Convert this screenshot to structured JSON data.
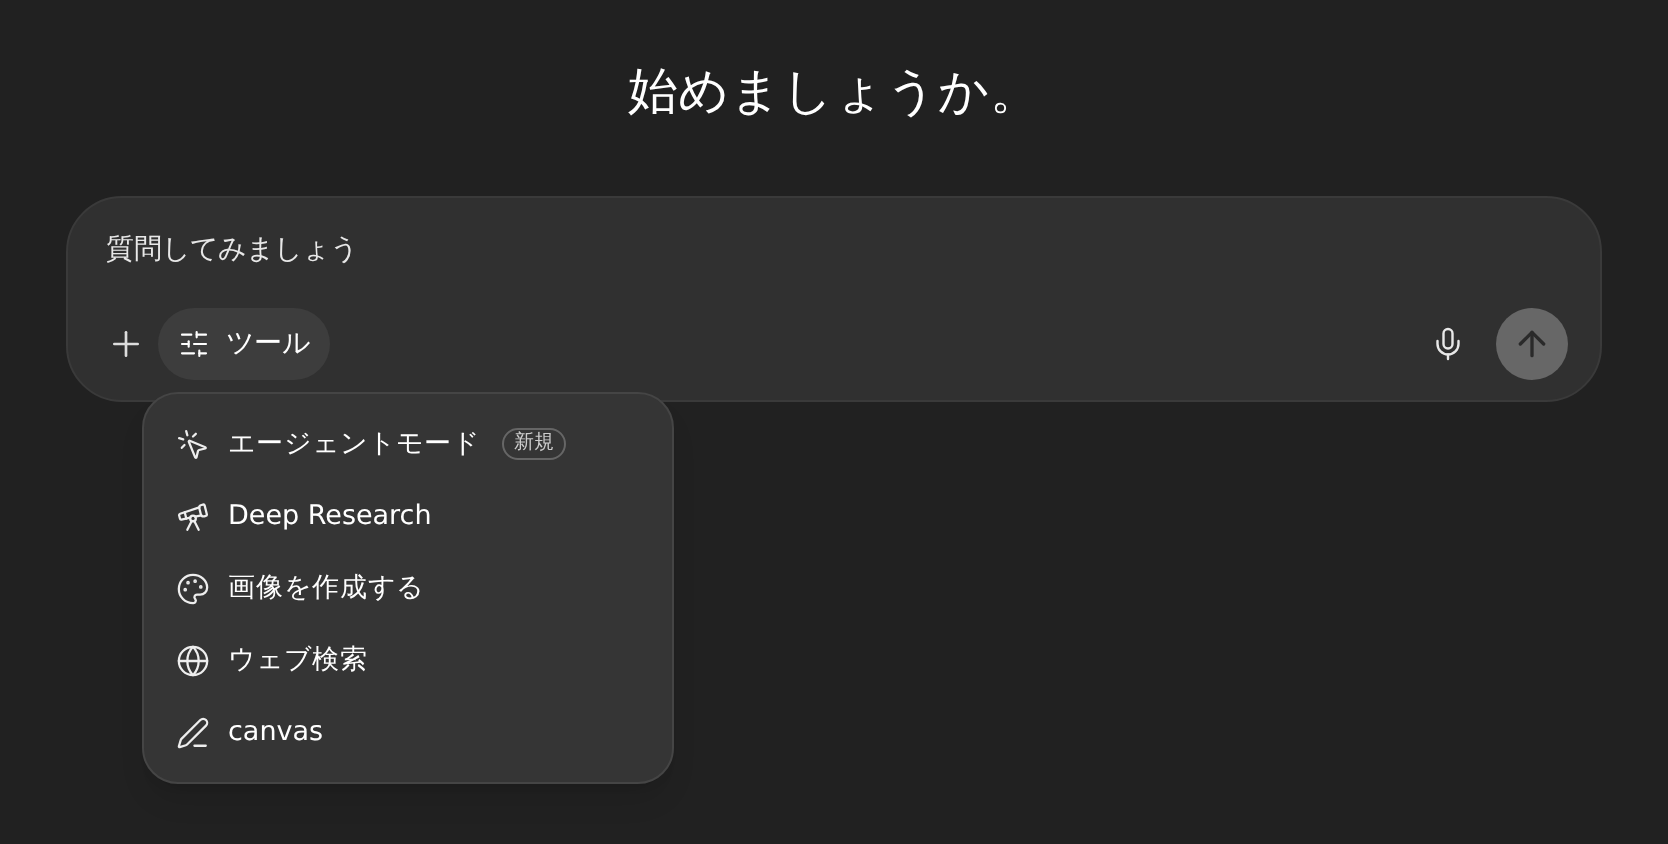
{
  "heading": "始めましょうか。",
  "composer": {
    "placeholder": "質問してみましょう",
    "tools_button": {
      "label": "ツール",
      "expanded": true
    },
    "send_button": {
      "disabled": true
    }
  },
  "tools_menu": [
    {
      "label": "エージェントモード",
      "badge": "新規"
    },
    {
      "label": "Deep Research"
    },
    {
      "label": "画像を作成する"
    },
    {
      "label": "ウェブ検索"
    },
    {
      "label": "canvas"
    }
  ]
}
